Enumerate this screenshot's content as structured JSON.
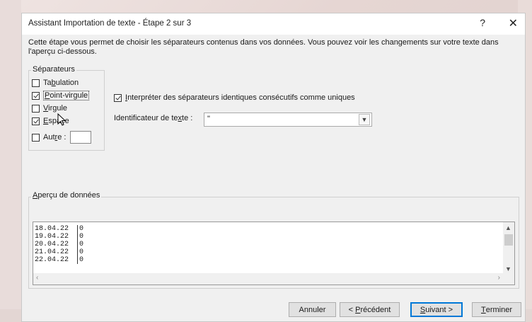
{
  "window": {
    "title": "Assistant Importation de texte - Étape 2 sur 3",
    "help": "?",
    "close": "✕"
  },
  "intro": "Cette étape vous permet de choisir les séparateurs contenus dans vos données. Vous pouvez voir les changements sur votre texte dans l'aperçu ci-dessous.",
  "separators": {
    "title": "Séparateurs",
    "items": [
      {
        "label": "Tabulation",
        "checked": false
      },
      {
        "label": "Point-virgule",
        "checked": true
      },
      {
        "label": "Virgule",
        "checked": false
      },
      {
        "label": "Espace",
        "checked": true
      },
      {
        "label": "Autre :",
        "checked": false
      }
    ]
  },
  "consecutive": {
    "label": "Interpréter des séparateurs identiques consécutifs comme uniques",
    "checked": true
  },
  "text_qualifier": {
    "label": "Identificateur de texte :",
    "value": "\""
  },
  "preview": {
    "title": "Aperçu de données",
    "rows": [
      [
        "18.04.22",
        "0"
      ],
      [
        "19.04.22",
        "0"
      ],
      [
        "20.04.22",
        "0"
      ],
      [
        "21.04.22",
        "0"
      ],
      [
        "22.04.22",
        "0"
      ]
    ]
  },
  "buttons": {
    "cancel": "Annuler",
    "previous": "< Précédent",
    "next": "Suivant >",
    "finish": "Terminer"
  },
  "colors": {
    "accent": "#0078d7",
    "dialog_bg": "#f0f0f0"
  }
}
